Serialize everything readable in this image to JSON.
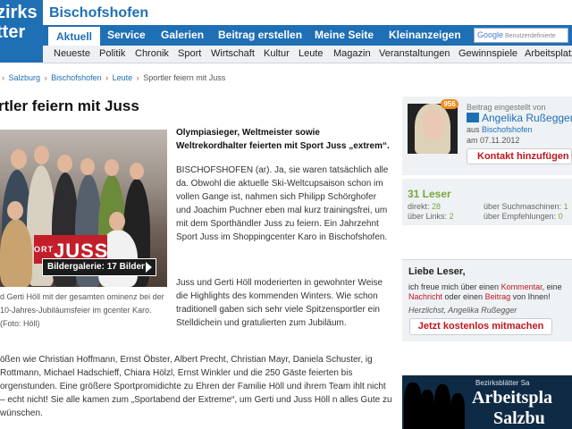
{
  "header": {
    "logo_line1": "zirks",
    "logo_line2": "tter",
    "region": "Bischofshofen"
  },
  "topnav": {
    "tabs": [
      "Aktuell",
      "Service",
      "Galerien",
      "Beitrag erstellen",
      "Meine Seite",
      "Kleinanzeigen"
    ],
    "active": "Aktuell",
    "search_brand": "Google",
    "search_placeholder": "Benutzerdefinierte"
  },
  "subnav": [
    "Neueste",
    "Politik",
    "Chronik",
    "Sport",
    "Wirtschaft",
    "Kultur",
    "Leute",
    "Magazin",
    "Veranstaltungen",
    "Gewinnspiele",
    "Arbeitsplatz"
  ],
  "breadcrumb": [
    "Salzburg",
    "Bischofshofen",
    "Leute",
    "Sportler feiern mit Juss"
  ],
  "article": {
    "headline": "rtler feiern mit Juss",
    "photo_sign": "JUSS",
    "sign_prefix": "ORT",
    "gallery_button": "Bildergalerie: 17 Bilder",
    "caption": "d Gerti Höll mit der gesamten ominenz bei der 10-Jahres-Jubiläumsfeier im gcenter Karo. (Foto: Höll)",
    "lead": "Olympiasieger, Weltmeister sowie Weltrekordhalter feierten mit Sport Juss „extrem“.",
    "p1": "BISCHOFSHOFEN (ar). Ja, sie waren tatsächlich alle da. Obwohl die aktuelle Ski-Weltcupsaison schon im vollen Gange ist, nahmen sich Philipp Schörghofer und Joachim Puchner eben mal kurz trainingsfrei, um mit dem Sporthändler Juss zu feiern. Ein Jahrzehnt Sport Juss im Shoppingcenter Karo in Bischofshofen.",
    "p2": "Juss und Gerti Höll moderierten in gewohnter Weise die Highlights des kommenden Winters. Wie schon traditionell gaben sich sehr viele Spitzensportler ein Stelldichein und gratulierten zum Jubiläum.",
    "p3": "ößen wie Christian Hoffmann, Ernst Öbster, Albert Precht, Christian Mayr, Daniela Schuster, ig Rottmann, Michael Hadschieff, Chiara Hölzl, Ernst Winkler und die 250 Gäste feierten bis orgenstunden. Eine größere Sportpromidichte zu Ehren der Familie Höll und ihrem Team ihlt nicht – echt nicht! Sie alle kamen zum „Sportabend der Extreme“, um Gerti und Juss Höll n alles Gute zu wünschen."
  },
  "author_box": {
    "badge": "956",
    "posted_label": "Beitrag eingestellt von",
    "name": "Angelika Rußegger",
    "from_prefix": "aus",
    "from_place": "Bischofshofen",
    "date": "am 07.11.2012",
    "contact_button": "Kontakt hinzufügen"
  },
  "stats": {
    "readers": "31 Leser",
    "direct_label": "direkt:",
    "direct_value": "28",
    "search_label": "über Suchmaschinen:",
    "search_value": "1",
    "links_label": "über Links:",
    "links_value": "2",
    "recommend_label": "über Empfehlungen:",
    "recommend_value": "0"
  },
  "hello_box": {
    "title": "Liebe Leser,",
    "text_1": "ich freue mich über einen ",
    "kommentar": "Kommentar",
    "text_2": ", eine ",
    "nachricht": "Nachricht",
    "text_3": " oder einen ",
    "beitrag": "Beitrag",
    "text_4": " von Ihnen!",
    "signature": "Herzlichst, Angelika Rußegger",
    "join_button": "Jetzt kostenlos mitmachen"
  },
  "promo": {
    "top": "Bezirksblätter Sa",
    "big": "Arbeitspla",
    "big2": "Salzbu"
  },
  "colors": {
    "brand_blue": "#1f6fb5",
    "accent_red": "#c0161f",
    "green": "#7aa83c"
  }
}
